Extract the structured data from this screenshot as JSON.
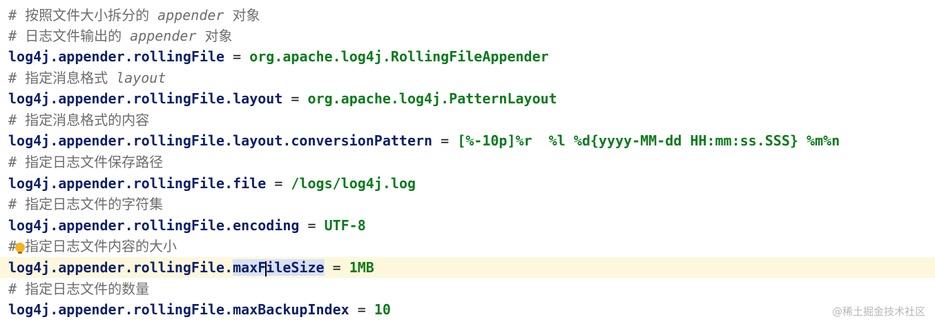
{
  "editor": {
    "lines": [
      {
        "type": "comment",
        "prefix": "# ",
        "text": "按照文件大小拆分的 ",
        "italic": "appender",
        "suffix": " 对象"
      },
      {
        "type": "comment",
        "prefix": "# ",
        "text": "日志文件输出的 ",
        "italic": "appender",
        "suffix": " 对象"
      },
      {
        "type": "prop",
        "key": "log4j.appender.rollingFile",
        "eq": " = ",
        "value": "org.apache.log4j.RollingFileAppender"
      },
      {
        "type": "comment",
        "prefix": "# ",
        "text": "指定消息格式 ",
        "italic": "layout",
        "suffix": ""
      },
      {
        "type": "prop",
        "key": "log4j.appender.rollingFile.layout",
        "eq": " = ",
        "value": "org.apache.log4j.PatternLayout"
      },
      {
        "type": "comment",
        "prefix": "# ",
        "text": "指定消息格式的内容",
        "italic": "",
        "suffix": ""
      },
      {
        "type": "prop",
        "key": "log4j.appender.rollingFile.layout.conversionPattern",
        "eq": " = ",
        "value": "[%-10p]%r  %l %d{yyyy-MM-dd HH:mm:ss.SSS} %m%n"
      },
      {
        "type": "comment",
        "prefix": "# ",
        "text": "指定日志文件保存路径",
        "italic": "",
        "suffix": ""
      },
      {
        "type": "prop",
        "key": "log4j.appender.rollingFile.file",
        "eq": " = ",
        "value": "/logs/log4j.log"
      },
      {
        "type": "comment",
        "prefix": "# ",
        "text": "指定日志文件的字符集",
        "italic": "",
        "suffix": ""
      },
      {
        "type": "prop",
        "key": "log4j.appender.rollingFile.encoding",
        "eq": " = ",
        "value": "UTF-8"
      },
      {
        "type": "comment",
        "prefix": "#",
        "text": "指定日志文件内容的大小",
        "italic": "",
        "suffix": ""
      },
      {
        "type": "prop",
        "key_before_caret": "log4j.appender.rollingFile.maxF",
        "key_after_caret": "ileSize",
        "key_plain": "log4j.appender.rollingFile.",
        "key_selected": "maxFileSize",
        "eq": " = ",
        "value": "1MB"
      },
      {
        "type": "comment",
        "prefix": "# ",
        "text": "指定日志文件的数量",
        "italic": "",
        "suffix": ""
      },
      {
        "type": "prop",
        "key": "log4j.appender.rollingFile.maxBackupIndex",
        "eq": " = ",
        "value": "10"
      }
    ]
  },
  "watermark": "@稀土掘金技术社区",
  "colors": {
    "key": "#0b1f6a",
    "value": "#0b7a1c",
    "comment": "#6d6d6d",
    "current_line": "#fdf7dc",
    "selection": "#d9e1f4",
    "bulb": "#f7b21d"
  }
}
